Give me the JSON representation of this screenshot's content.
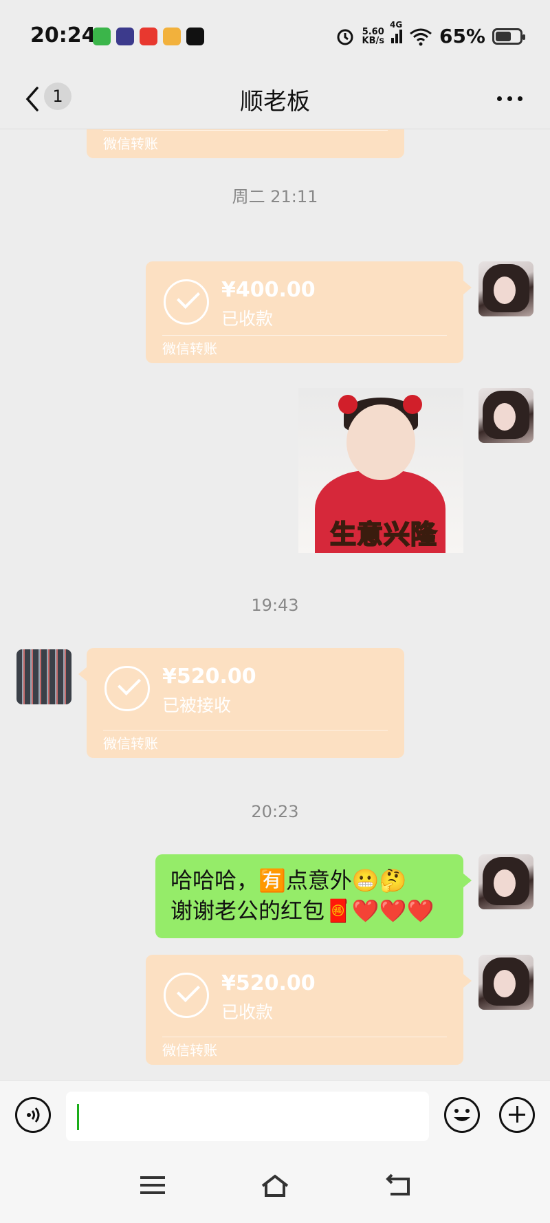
{
  "status_bar": {
    "time": "20:24",
    "net_speed_value": "5.60",
    "net_speed_unit": "KB/s",
    "network_type": "4G",
    "battery_percent": "65%",
    "battery_level": 0.65
  },
  "header": {
    "unread_badge": "1",
    "title": "顺老板"
  },
  "timestamps": [
    "周二 21:11",
    "19:43",
    "20:23"
  ],
  "messages": {
    "partial_top": {
      "footer": "微信转账"
    },
    "transfer_1": {
      "amount": "¥400.00",
      "status": "已收款",
      "footer": "微信转账"
    },
    "sticker": {
      "caption": "生意兴隆"
    },
    "transfer_2": {
      "amount": "¥520.00",
      "status": "已被接收",
      "footer": "微信转账"
    },
    "text": {
      "line1": "哈哈哈，🈶点意外😬🤔",
      "line2": "谢谢老公的红包🧧❤️❤️❤️"
    },
    "transfer_3": {
      "amount": "¥520.00",
      "status": "已收款",
      "footer": "微信转账"
    }
  },
  "colors": {
    "background": "#ededed",
    "transfer_bubble": "#fce0c2",
    "text_bubble": "#95ec69",
    "caret": "#1aad19"
  }
}
